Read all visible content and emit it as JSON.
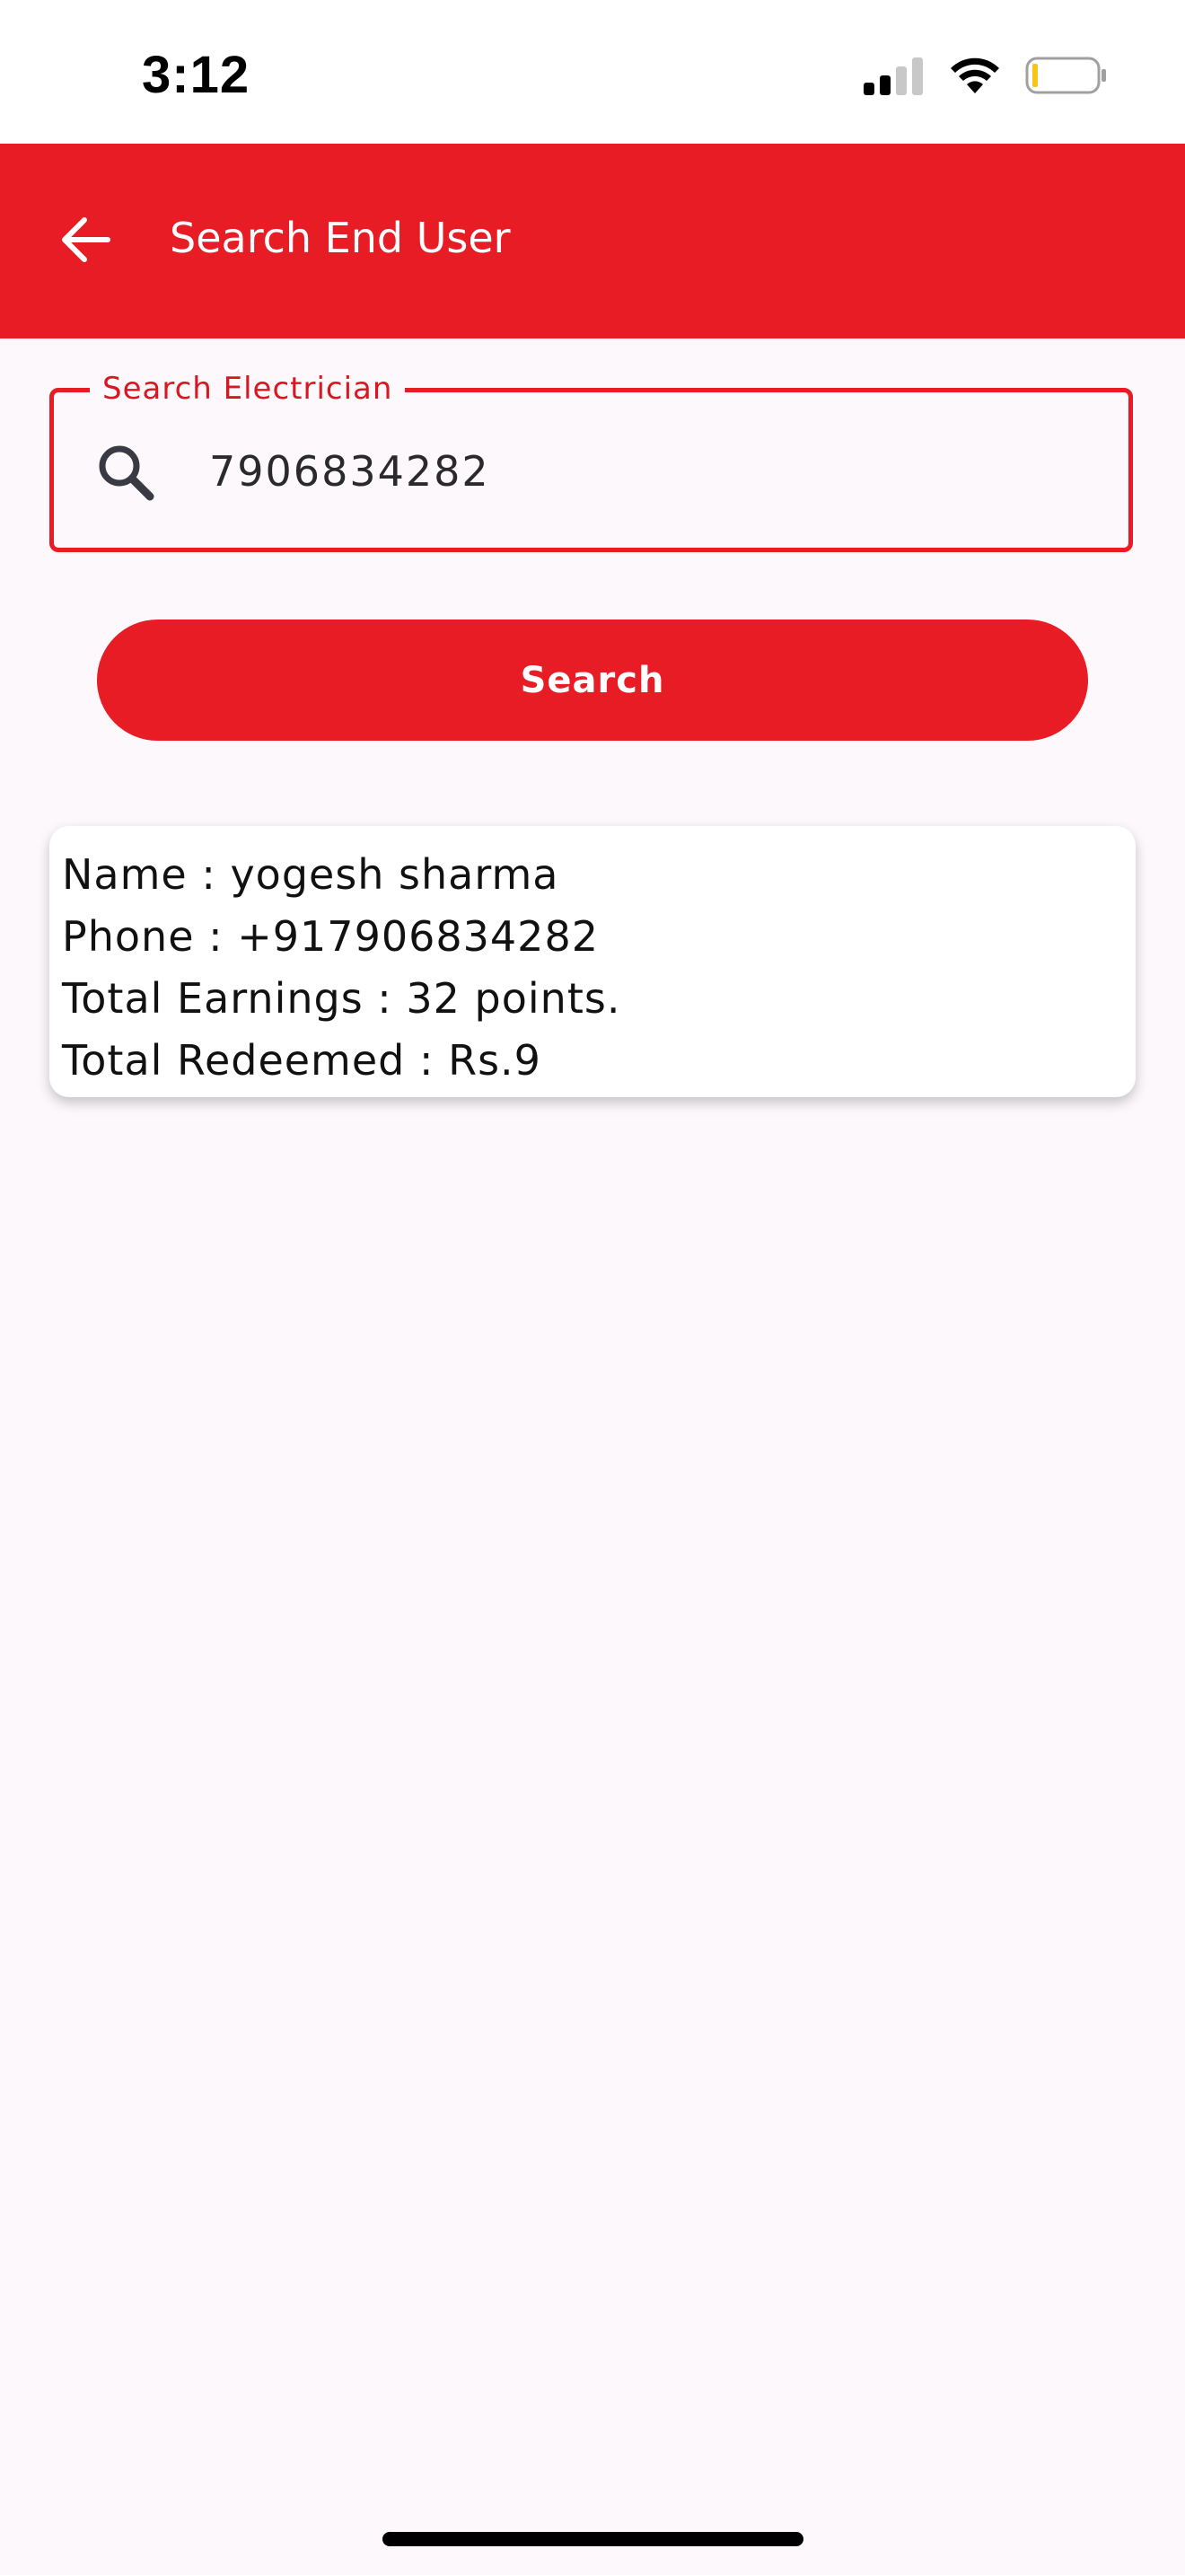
{
  "status_bar": {
    "time": "3:12"
  },
  "appbar": {
    "title": "Search End User",
    "background_color": "#e81c24"
  },
  "search_field": {
    "label": "Search Electrician",
    "value": "7906834282",
    "icon": "search-icon"
  },
  "search_button": {
    "label": "Search"
  },
  "result": {
    "lines": [
      "Name : yogesh sharma",
      "Phone : +917906834282",
      "Total Earnings : 32 points.",
      "Total Redeemed : Rs.9"
    ]
  }
}
